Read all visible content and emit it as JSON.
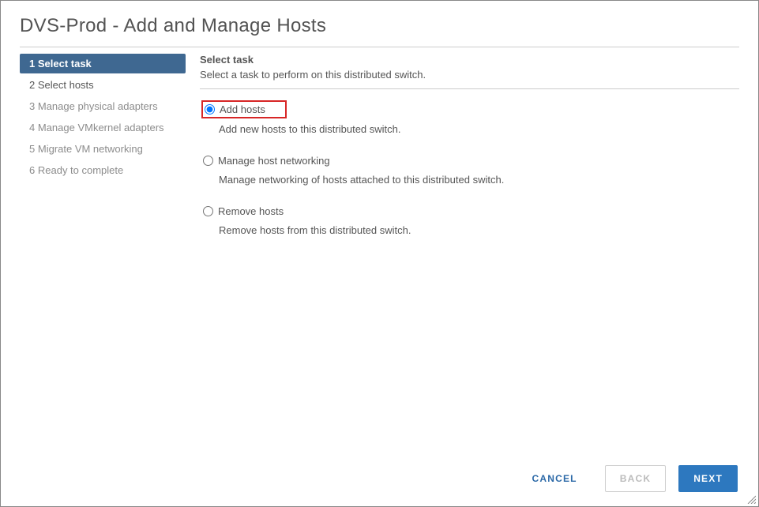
{
  "dialog": {
    "title": "DVS-Prod - Add and Manage Hosts"
  },
  "wizard": {
    "steps": [
      {
        "num": "1",
        "label": "Select task"
      },
      {
        "num": "2",
        "label": "Select hosts"
      },
      {
        "num": "3",
        "label": "Manage physical adapters"
      },
      {
        "num": "4",
        "label": "Manage VMkernel adapters"
      },
      {
        "num": "5",
        "label": "Migrate VM networking"
      },
      {
        "num": "6",
        "label": "Ready to complete"
      }
    ]
  },
  "content": {
    "heading": "Select task",
    "description": "Select a task to perform on this distributed switch.",
    "options": [
      {
        "label": "Add hosts",
        "desc": "Add new hosts to this distributed switch."
      },
      {
        "label": "Manage host networking",
        "desc": "Manage networking of hosts attached to this distributed switch."
      },
      {
        "label": "Remove hosts",
        "desc": "Remove hosts from this distributed switch."
      }
    ]
  },
  "footer": {
    "cancel": "CANCEL",
    "back": "BACK",
    "next": "NEXT"
  }
}
